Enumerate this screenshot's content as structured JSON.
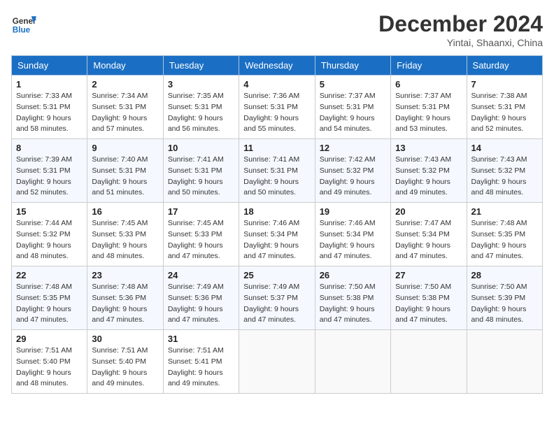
{
  "header": {
    "logo_line1": "General",
    "logo_line2": "Blue",
    "month_title": "December 2024",
    "location": "Yintai, Shaanxi, China"
  },
  "weekdays": [
    "Sunday",
    "Monday",
    "Tuesday",
    "Wednesday",
    "Thursday",
    "Friday",
    "Saturday"
  ],
  "weeks": [
    [
      {
        "day": 1,
        "sunrise": "Sunrise: 7:33 AM",
        "sunset": "Sunset: 5:31 PM",
        "daylight": "Daylight: 9 hours and 58 minutes."
      },
      {
        "day": 2,
        "sunrise": "Sunrise: 7:34 AM",
        "sunset": "Sunset: 5:31 PM",
        "daylight": "Daylight: 9 hours and 57 minutes."
      },
      {
        "day": 3,
        "sunrise": "Sunrise: 7:35 AM",
        "sunset": "Sunset: 5:31 PM",
        "daylight": "Daylight: 9 hours and 56 minutes."
      },
      {
        "day": 4,
        "sunrise": "Sunrise: 7:36 AM",
        "sunset": "Sunset: 5:31 PM",
        "daylight": "Daylight: 9 hours and 55 minutes."
      },
      {
        "day": 5,
        "sunrise": "Sunrise: 7:37 AM",
        "sunset": "Sunset: 5:31 PM",
        "daylight": "Daylight: 9 hours and 54 minutes."
      },
      {
        "day": 6,
        "sunrise": "Sunrise: 7:37 AM",
        "sunset": "Sunset: 5:31 PM",
        "daylight": "Daylight: 9 hours and 53 minutes."
      },
      {
        "day": 7,
        "sunrise": "Sunrise: 7:38 AM",
        "sunset": "Sunset: 5:31 PM",
        "daylight": "Daylight: 9 hours and 52 minutes."
      }
    ],
    [
      {
        "day": 8,
        "sunrise": "Sunrise: 7:39 AM",
        "sunset": "Sunset: 5:31 PM",
        "daylight": "Daylight: 9 hours and 52 minutes."
      },
      {
        "day": 9,
        "sunrise": "Sunrise: 7:40 AM",
        "sunset": "Sunset: 5:31 PM",
        "daylight": "Daylight: 9 hours and 51 minutes."
      },
      {
        "day": 10,
        "sunrise": "Sunrise: 7:41 AM",
        "sunset": "Sunset: 5:31 PM",
        "daylight": "Daylight: 9 hours and 50 minutes."
      },
      {
        "day": 11,
        "sunrise": "Sunrise: 7:41 AM",
        "sunset": "Sunset: 5:31 PM",
        "daylight": "Daylight: 9 hours and 50 minutes."
      },
      {
        "day": 12,
        "sunrise": "Sunrise: 7:42 AM",
        "sunset": "Sunset: 5:32 PM",
        "daylight": "Daylight: 9 hours and 49 minutes."
      },
      {
        "day": 13,
        "sunrise": "Sunrise: 7:43 AM",
        "sunset": "Sunset: 5:32 PM",
        "daylight": "Daylight: 9 hours and 49 minutes."
      },
      {
        "day": 14,
        "sunrise": "Sunrise: 7:43 AM",
        "sunset": "Sunset: 5:32 PM",
        "daylight": "Daylight: 9 hours and 48 minutes."
      }
    ],
    [
      {
        "day": 15,
        "sunrise": "Sunrise: 7:44 AM",
        "sunset": "Sunset: 5:32 PM",
        "daylight": "Daylight: 9 hours and 48 minutes."
      },
      {
        "day": 16,
        "sunrise": "Sunrise: 7:45 AM",
        "sunset": "Sunset: 5:33 PM",
        "daylight": "Daylight: 9 hours and 48 minutes."
      },
      {
        "day": 17,
        "sunrise": "Sunrise: 7:45 AM",
        "sunset": "Sunset: 5:33 PM",
        "daylight": "Daylight: 9 hours and 47 minutes."
      },
      {
        "day": 18,
        "sunrise": "Sunrise: 7:46 AM",
        "sunset": "Sunset: 5:34 PM",
        "daylight": "Daylight: 9 hours and 47 minutes."
      },
      {
        "day": 19,
        "sunrise": "Sunrise: 7:46 AM",
        "sunset": "Sunset: 5:34 PM",
        "daylight": "Daylight: 9 hours and 47 minutes."
      },
      {
        "day": 20,
        "sunrise": "Sunrise: 7:47 AM",
        "sunset": "Sunset: 5:34 PM",
        "daylight": "Daylight: 9 hours and 47 minutes."
      },
      {
        "day": 21,
        "sunrise": "Sunrise: 7:48 AM",
        "sunset": "Sunset: 5:35 PM",
        "daylight": "Daylight: 9 hours and 47 minutes."
      }
    ],
    [
      {
        "day": 22,
        "sunrise": "Sunrise: 7:48 AM",
        "sunset": "Sunset: 5:35 PM",
        "daylight": "Daylight: 9 hours and 47 minutes."
      },
      {
        "day": 23,
        "sunrise": "Sunrise: 7:48 AM",
        "sunset": "Sunset: 5:36 PM",
        "daylight": "Daylight: 9 hours and 47 minutes."
      },
      {
        "day": 24,
        "sunrise": "Sunrise: 7:49 AM",
        "sunset": "Sunset: 5:36 PM",
        "daylight": "Daylight: 9 hours and 47 minutes."
      },
      {
        "day": 25,
        "sunrise": "Sunrise: 7:49 AM",
        "sunset": "Sunset: 5:37 PM",
        "daylight": "Daylight: 9 hours and 47 minutes."
      },
      {
        "day": 26,
        "sunrise": "Sunrise: 7:50 AM",
        "sunset": "Sunset: 5:38 PM",
        "daylight": "Daylight: 9 hours and 47 minutes."
      },
      {
        "day": 27,
        "sunrise": "Sunrise: 7:50 AM",
        "sunset": "Sunset: 5:38 PM",
        "daylight": "Daylight: 9 hours and 47 minutes."
      },
      {
        "day": 28,
        "sunrise": "Sunrise: 7:50 AM",
        "sunset": "Sunset: 5:39 PM",
        "daylight": "Daylight: 9 hours and 48 minutes."
      }
    ],
    [
      {
        "day": 29,
        "sunrise": "Sunrise: 7:51 AM",
        "sunset": "Sunset: 5:40 PM",
        "daylight": "Daylight: 9 hours and 48 minutes."
      },
      {
        "day": 30,
        "sunrise": "Sunrise: 7:51 AM",
        "sunset": "Sunset: 5:40 PM",
        "daylight": "Daylight: 9 hours and 49 minutes."
      },
      {
        "day": 31,
        "sunrise": "Sunrise: 7:51 AM",
        "sunset": "Sunset: 5:41 PM",
        "daylight": "Daylight: 9 hours and 49 minutes."
      },
      null,
      null,
      null,
      null
    ]
  ]
}
